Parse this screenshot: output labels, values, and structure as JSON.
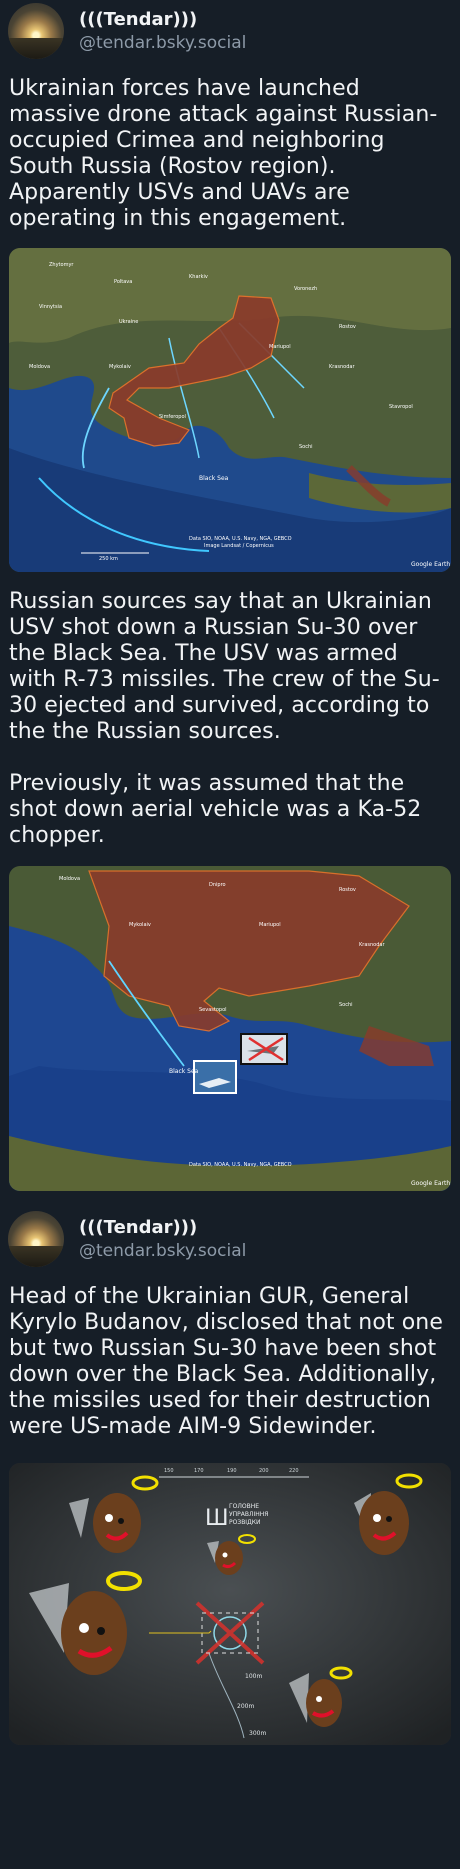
{
  "posts": [
    {
      "display_name": "(((Tendar)))",
      "handle": "@tendar.bsky.social",
      "text": "Ukrainian forces have launched massive drone attack against Russian-occupied Crimea and neighboring South Russia (Rostov region). Apparently USVs and UAVs are operating in this engagement."
    },
    {
      "text": "Russian sources say that an Ukrainian USV shot down a Russian Su-30 over the Black Sea. The USV was armed with R-73 missiles. The crew of the Su-30 ejected and survived, according to the the Russian sources.\n\nPreviously, it was assumed that the shot down aerial vehicle was a Ka-52 chopper."
    },
    {
      "display_name": "(((Tendar)))",
      "handle": "@tendar.bsky.social",
      "text": "Head of the Ukrainian GUR, General Kyrylo Budanov, disclosed that not one but two Russian Su-30 have been shot down over the Black Sea. Additionally, the missiles used for their destruction were US-made AIM-9 Sidewinder."
    }
  ],
  "map1": {
    "sea_label": "Black Sea",
    "scale_label": "250 km",
    "credit": "Data SIO, NOAA, U.S. Navy, NGA, GEBCO",
    "credit2": "Image Landsat / Copernicus",
    "brand": "Google Earth"
  },
  "map2": {
    "sea_label": "Black Sea",
    "credit": "Data SIO, NOAA, U.S. Navy, NGA, GEBCO",
    "brand": "Google Earth"
  },
  "video": {
    "emblem_line1": "ГОЛОВНЕ",
    "emblem_line2": "УПРАВЛІННЯ",
    "emblem_line3": "РОЗВІДКИ",
    "range1": "100m",
    "range2": "200m",
    "range3": "300m",
    "heading_ticks": [
      "150",
      "170",
      "190",
      "200",
      "220"
    ]
  }
}
